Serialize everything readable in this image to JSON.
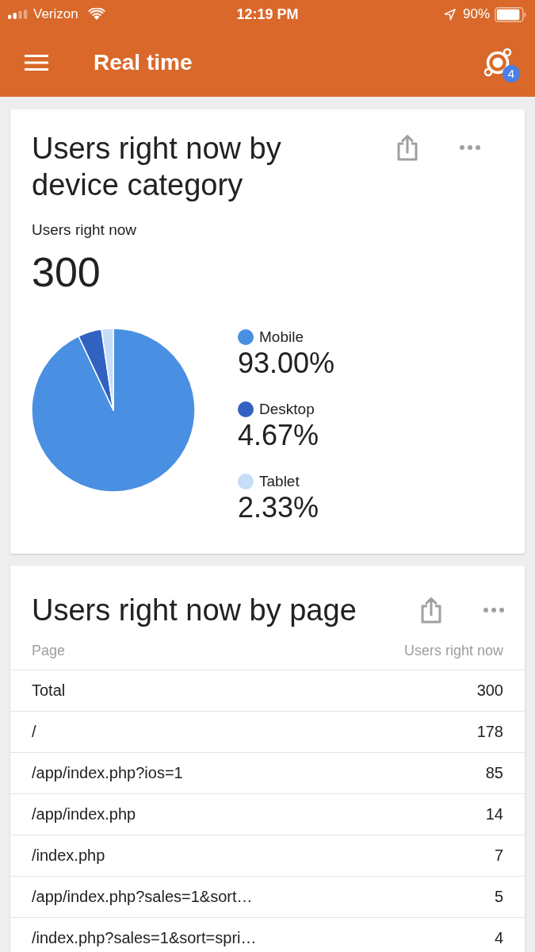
{
  "status_bar": {
    "carrier": "Verizon",
    "time": "12:19 PM",
    "battery": "90%"
  },
  "app_bar": {
    "title": "Real time",
    "badge": "4"
  },
  "device_card": {
    "title": "Users right now by device category",
    "metric_label": "Users right now",
    "metric_value": "300",
    "legend": [
      {
        "value": "93.00%",
        "color": "#4a90e2"
      },
      {
        "value": "4.67%",
        "color": "#3162c1"
      },
      {
        "value": "2.33%",
        "color": "#c5ddf7"
      }
    ],
    "chart_data": {
      "type": "pie",
      "categories": [
        "Mobile",
        "Desktop",
        "Tablet"
      ],
      "values": [
        93.0,
        4.67,
        2.33
      ]
    }
  },
  "page_card": {
    "title": "Users right now by page",
    "table": {
      "columns": [
        "Page",
        "Users right now"
      ],
      "rows": [
        {
          "page": "Total",
          "users": "300"
        },
        {
          "page": "/",
          "users": "178"
        },
        {
          "page": "/app/index.php?ios=1",
          "users": "85"
        },
        {
          "page": "/app/index.php",
          "users": "14"
        },
        {
          "page": "/index.php",
          "users": "7"
        },
        {
          "page": "/app/index.php?sales=1&sort…",
          "users": "5"
        },
        {
          "page": "/index.php?sales=1&sort=spri…",
          "users": "4"
        }
      ]
    }
  }
}
